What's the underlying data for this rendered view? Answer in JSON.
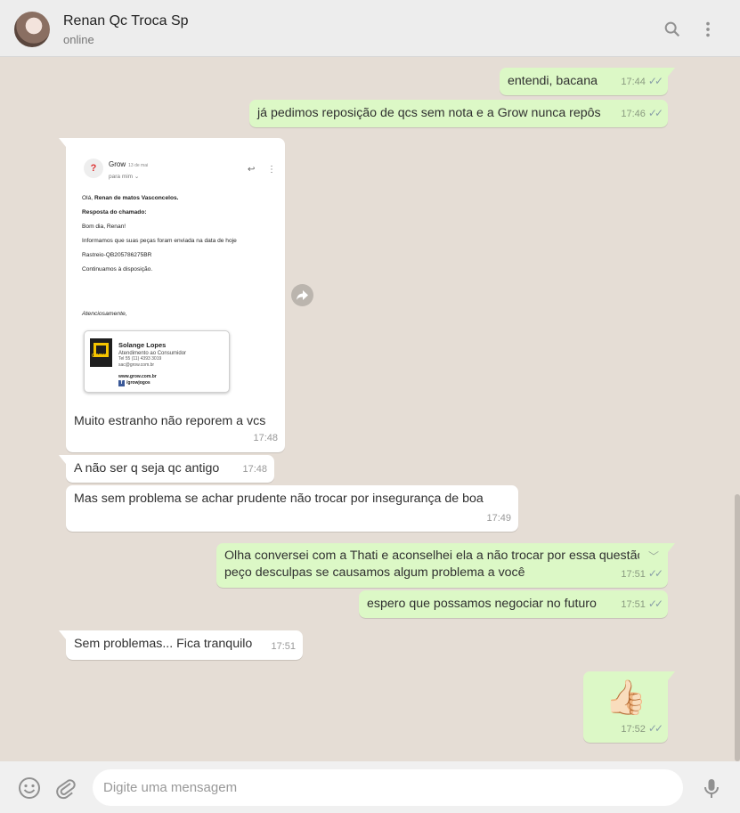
{
  "header": {
    "contact_name": "Renan Qc Troca Sp",
    "status": "online",
    "icons": [
      "search-icon",
      "menu-icon"
    ]
  },
  "messages": [
    {
      "dir": "out",
      "text": "entendi, bacana",
      "time": "17:44",
      "ticks": "read"
    },
    {
      "dir": "out",
      "text": "já pedimos reposição de qcs sem nota e a Grow nunca repôs",
      "time": "17:46",
      "ticks": "read"
    },
    {
      "dir": "in",
      "type": "image-caption",
      "text": "Muito estranho não reporem a vcs",
      "time": "17:48"
    },
    {
      "dir": "in",
      "text": "A não ser q seja qc antigo",
      "time": "17:48"
    },
    {
      "dir": "in",
      "text": "Mas sem problema se achar prudente não trocar por insegurança de boa",
      "time": "17:49"
    },
    {
      "dir": "out",
      "line1": "Olha conversei com a Thati e aconselhei ela a não trocar por essa questão,",
      "line2": "peço desculpas se causamos algum problema a você",
      "time": "17:51",
      "ticks": "read"
    },
    {
      "dir": "out",
      "text": "espero que possamos negociar no futuro",
      "time": "17:51",
      "ticks": "read"
    },
    {
      "dir": "in",
      "text": "Sem problemas... Fica tranquilo",
      "time": "17:51"
    },
    {
      "dir": "out",
      "type": "emoji",
      "text": "👍🏻",
      "time": "17:52",
      "ticks": "read"
    }
  ],
  "email": {
    "sender": "Grow",
    "date": "13 de mai",
    "to": "para mim",
    "greeting_prefix": "Olá,",
    "greeting_name": "Renan de matos Vasconcelos.",
    "reply_header": "Resposta do chamado:",
    "line1": "Bom dia, Renan!",
    "line2": "Informamos que suas peças  foram enviada na data de hoje",
    "line3": "Rastreio-QB205786275BR",
    "line4": "Continuamos à disposição.",
    "closing": "Atenciosamente,",
    "signature": {
      "name": "Solange Lopes",
      "role": "Atendimento ao Consumidor",
      "phone": "Tel 55 (11) 4393 3019",
      "email": "sac@grow.com.br",
      "site": "www.grow.com.br",
      "social": "/growjogos",
      "logo_text": "GROW"
    }
  },
  "composer": {
    "placeholder": "Digite uma mensagem",
    "icons": [
      "emoji-icon",
      "attach-icon",
      "mic-icon"
    ]
  },
  "colors": {
    "outgoing": "#dcf8c6",
    "incoming": "#ffffff",
    "background": "#e5ddd5",
    "header": "#ededed"
  }
}
